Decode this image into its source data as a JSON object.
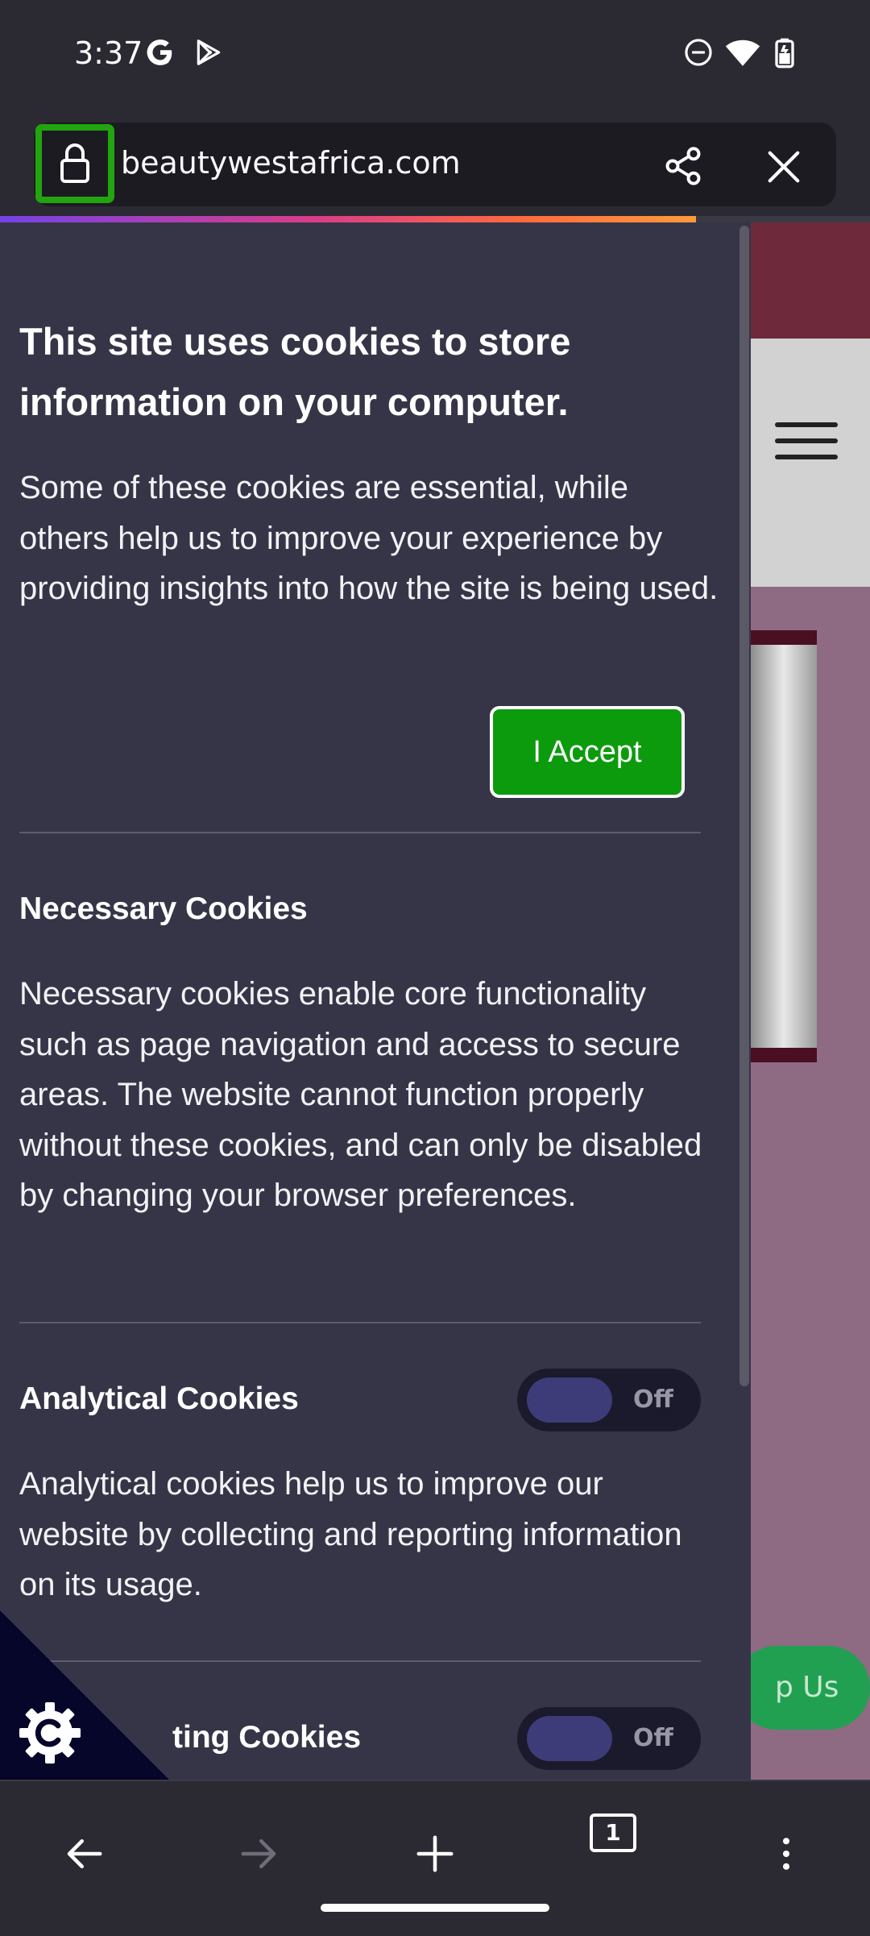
{
  "status_bar": {
    "time": "3:37",
    "icons": [
      "google-icon",
      "play-store-icon",
      "do-not-disturb-icon",
      "wifi-icon",
      "battery-icon"
    ]
  },
  "browser": {
    "url": "beautywestafrica.com",
    "tab_count": "1",
    "accent_color": "#22a40e",
    "page_load_progress": 0.8
  },
  "cookie_banner": {
    "title": "This site uses cookies to store information on your computer.",
    "intro": "Some of these cookies are essential, while others help us to improve your experience by providing insights into how the site is being used.",
    "accept_label": "I Accept",
    "accept_color": "#0d9b0e",
    "sections": [
      {
        "title": "Necessary Cookies",
        "description": "Necessary cookies enable core functionality such as page navigation and access to secure areas. The website cannot function properly without these cookies, and can only be disabled by changing your browser preferences."
      },
      {
        "title": "Analytical Cookies",
        "toggle_label": "Off",
        "description": "Analytical cookies help us to improve our website by collecting and reporting information on its usage."
      },
      {
        "title": "ting Cookies",
        "toggle_label": "Off"
      }
    ]
  },
  "background_page": {
    "help_button_text": "p Us"
  }
}
